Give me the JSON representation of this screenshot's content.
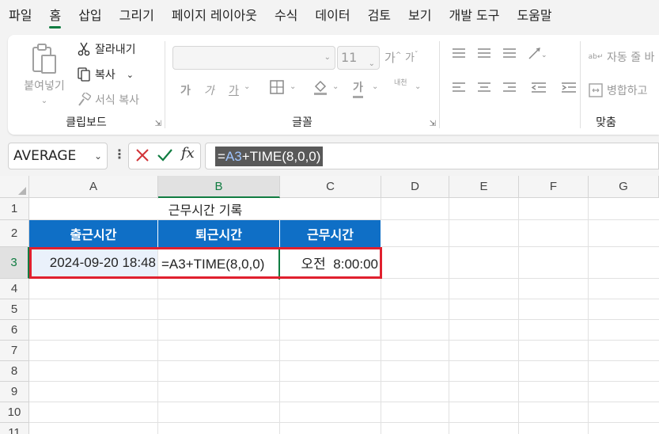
{
  "menu": {
    "items": [
      "파일",
      "홈",
      "삽입",
      "그리기",
      "페이지 레이아웃",
      "수식",
      "데이터",
      "검토",
      "보기",
      "개발 도구",
      "도움말"
    ],
    "active_index": 1
  },
  "ribbon": {
    "clipboard": {
      "label": "클립보드",
      "paste": "붙여넣기",
      "cut": "잘라내기",
      "copy": "복사",
      "format_painter": "서식 복사"
    },
    "font": {
      "label": "글꼴",
      "font_name": "",
      "font_size": "11",
      "bold": "가",
      "italic": "가",
      "underline": "가",
      "font_color": "가",
      "phonetic": "내천"
    },
    "alignment": {
      "label": "맞춤",
      "wrap": "자동 줄 바",
      "merge": "병합하고"
    }
  },
  "formula_bar": {
    "name_box": "AVERAGE",
    "formula_prefix": "=",
    "formula_ref": "A3",
    "formula_rest": "+TIME(8,0,0)"
  },
  "sheet": {
    "columns": [
      "A",
      "B",
      "C",
      "D",
      "E",
      "F",
      "G"
    ],
    "rows": [
      "1",
      "2",
      "3",
      "4",
      "5",
      "6",
      "7",
      "8",
      "9",
      "10",
      "11"
    ],
    "selected_column": "B",
    "selected_row": "3",
    "title": "근무시간 기록",
    "headers": [
      "출근시간",
      "퇴근시간",
      "근무시간"
    ],
    "row3": {
      "a": "2024-09-20 18:48",
      "b": "=A3+TIME(8,0,0)",
      "c": "오전  8:00:00"
    }
  },
  "colors": {
    "accent": "#107c41",
    "header_fill": "#0f6fc6",
    "highlight_border": "#e0202e"
  }
}
